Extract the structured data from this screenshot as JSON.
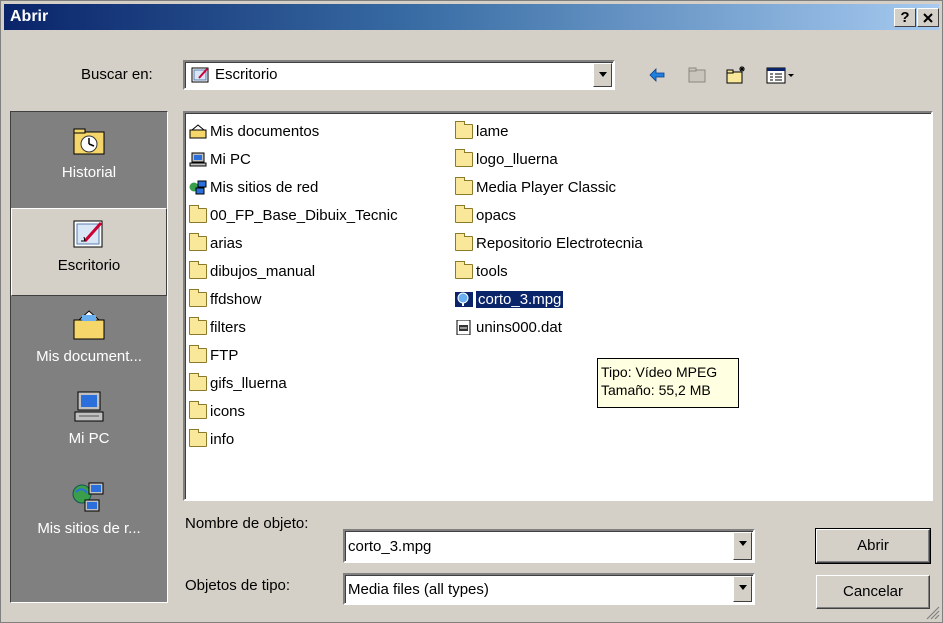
{
  "window": {
    "title": "Abrir",
    "help_label": "?",
    "close_label": "x"
  },
  "toolbar": {
    "look_in_label": "Buscar en:",
    "look_in_value": "Escritorio",
    "icons": [
      "back-icon",
      "up-folder-icon",
      "new-folder-icon",
      "view-menu-icon"
    ]
  },
  "places": [
    {
      "label": "Historial",
      "icon": "history-icon"
    },
    {
      "label": "Escritorio",
      "icon": "desktop-icon",
      "selected": true
    },
    {
      "label": "Mis document...",
      "icon": "my-documents-icon"
    },
    {
      "label": "Mi PC",
      "icon": "my-computer-icon"
    },
    {
      "label": "Mis sitios de r...",
      "icon": "network-places-icon"
    }
  ],
  "files": {
    "col1": [
      {
        "name": "Mis documentos",
        "icon": "my-documents-icon"
      },
      {
        "name": "Mi PC",
        "icon": "my-computer-icon"
      },
      {
        "name": "Mis sitios de red",
        "icon": "network-places-icon"
      },
      {
        "name": "00_FP_Base_Dibuix_Tecnic",
        "icon": "folder-icon"
      },
      {
        "name": "arias",
        "icon": "folder-icon"
      },
      {
        "name": "dibujos_manual",
        "icon": "folder-icon"
      },
      {
        "name": "ffdshow",
        "icon": "folder-icon"
      },
      {
        "name": "filters",
        "icon": "folder-icon"
      },
      {
        "name": "FTP",
        "icon": "folder-icon"
      },
      {
        "name": "gifs_lluerna",
        "icon": "folder-icon"
      },
      {
        "name": "icons",
        "icon": "folder-icon"
      },
      {
        "name": "info",
        "icon": "folder-icon"
      }
    ],
    "col2": [
      {
        "name": "lame",
        "icon": "folder-icon"
      },
      {
        "name": "logo_lluerna",
        "icon": "folder-icon"
      },
      {
        "name": "Media Player Classic",
        "icon": "folder-icon"
      },
      {
        "name": "opacs",
        "icon": "folder-icon"
      },
      {
        "name": "Repositorio Electrotecnia",
        "icon": "folder-icon"
      },
      {
        "name": "tools",
        "icon": "folder-icon"
      },
      {
        "name": "corto_3.mpg",
        "icon": "media-file-icon",
        "selected": true
      },
      {
        "name": "unins000.dat",
        "icon": "dat-file-icon"
      }
    ]
  },
  "tooltip": {
    "line1": "Tipo: Vídeo MPEG",
    "line2": "Tamaño: 55,2 MB"
  },
  "bottom": {
    "filename_label": "Nombre de objeto:",
    "filename_value": "corto_3.mpg",
    "filetype_label": "Objetos de tipo:",
    "filetype_value": "Media files (all types)",
    "open_label": "Abrir",
    "cancel_label": "Cancelar"
  }
}
